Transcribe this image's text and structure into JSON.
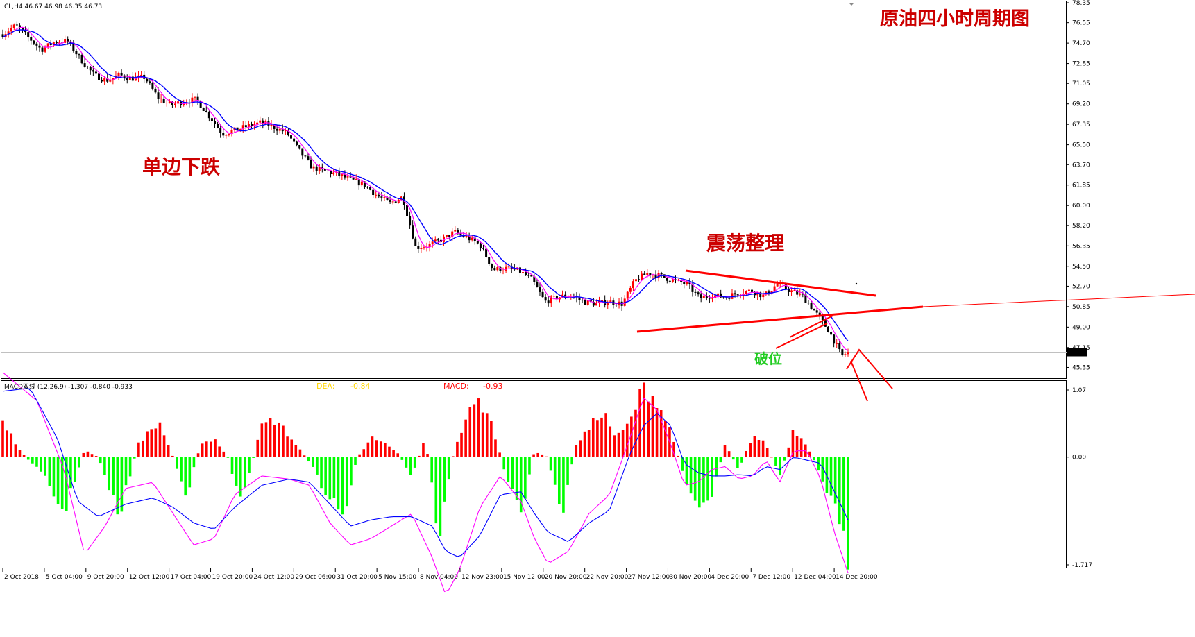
{
  "header": {
    "symbol_info": "CL,H4  46.67 46.98 46.35 46.73",
    "chart_title": "原油四小时周期图"
  },
  "annotations": {
    "trend": "单边下跌",
    "consolidation": "震荡整理",
    "breakdown": "破位"
  },
  "macd_header": {
    "label": "MACD双线 (12,26,9) -1.307 -0.840 -0.933",
    "dea_label": "DEA:",
    "dea_value": "-0.84",
    "macd_label": "MACD:",
    "macd_value": "-0.93"
  },
  "colors": {
    "bull_candle": "#ff0000",
    "bear_candle": "#000000",
    "ma_fast": "#ff00ff",
    "ma_slow": "#0000ff",
    "hist_positive": "#ff0000",
    "hist_negative": "#00ff00",
    "dea_label": "#ffd700",
    "macd_label": "#ff0000",
    "annotation_red": "#cc0000",
    "annotation_green": "#22cc22",
    "trendline": "#ff0000"
  },
  "chart_data": [
    {
      "type": "candlestick",
      "symbol": "CL",
      "timeframe": "H4",
      "last_price": "46.73",
      "ylim": [
        44.5,
        78.35
      ],
      "y_ticks": [
        "78.35",
        "76.55",
        "74.70",
        "72.85",
        "71.05",
        "69.20",
        "67.35",
        "65.50",
        "63.70",
        "61.85",
        "60.00",
        "58.20",
        "56.35",
        "54.50",
        "52.70",
        "50.85",
        "49.00",
        "47.15",
        "45.35"
      ],
      "x_ticks": [
        "2 Oct 2018",
        "5 Oct 04:00",
        "9 Oct 20:00",
        "12 Oct 12:00",
        "17 Oct 04:00",
        "19 Oct 20:00",
        "24 Oct 12:00",
        "29 Oct 06:00",
        "31 Oct 20:00",
        "5 Nov 15:00",
        "8 Nov 04:00",
        "12 Nov 23:00",
        "15 Nov 12:00",
        "20 Nov 20:00",
        "22 Nov 20:00",
        "27 Nov 12:00",
        "30 Nov 20:00",
        "4 Dec 20:00",
        "7 Dec 12:00",
        "12 Dec 04:00",
        "14 Dec 20:00"
      ],
      "price_path": [
        [
          0,
          75.5
        ],
        [
          2,
          76.3
        ],
        [
          4,
          75.2
        ],
        [
          6,
          74.1
        ],
        [
          8,
          74.8
        ],
        [
          10,
          74.9
        ],
        [
          12,
          73.3
        ],
        [
          14,
          71.9
        ],
        [
          16,
          71.3
        ],
        [
          18,
          71.8
        ],
        [
          20,
          71.5
        ],
        [
          22,
          71.6
        ],
        [
          24,
          69.8
        ],
        [
          26,
          69.1
        ],
        [
          28,
          69.4
        ],
        [
          30,
          69.6
        ],
        [
          32,
          68.1
        ],
        [
          34,
          66.5
        ],
        [
          36,
          66.8
        ],
        [
          38,
          67.2
        ],
        [
          40,
          67.5
        ],
        [
          42,
          67.1
        ],
        [
          44,
          66.6
        ],
        [
          46,
          64.9
        ],
        [
          48,
          63.4
        ],
        [
          50,
          63.1
        ],
        [
          52,
          62.8
        ],
        [
          54,
          62.3
        ],
        [
          56,
          61.9
        ],
        [
          58,
          60.9
        ],
        [
          60,
          60.2
        ],
        [
          62,
          60.8
        ],
        [
          64,
          56.2
        ],
        [
          66,
          56.4
        ],
        [
          68,
          56.9
        ],
        [
          70,
          57.6
        ],
        [
          72,
          57.1
        ],
        [
          74,
          56.4
        ],
        [
          76,
          54.2
        ],
        [
          78,
          54.3
        ],
        [
          80,
          54.1
        ],
        [
          82,
          53.3
        ],
        [
          84,
          51.3
        ],
        [
          86,
          51.7
        ],
        [
          88,
          51.9
        ],
        [
          90,
          51.3
        ],
        [
          92,
          51.1
        ],
        [
          94,
          51.3
        ],
        [
          96,
          51.1
        ],
        [
          98,
          53.2
        ],
        [
          100,
          53.9
        ],
        [
          102,
          53.6
        ],
        [
          104,
          53.2
        ],
        [
          106,
          52.9
        ],
        [
          108,
          51.6
        ],
        [
          110,
          51.9
        ],
        [
          112,
          51.7
        ],
        [
          114,
          52.1
        ],
        [
          116,
          52.3
        ],
        [
          118,
          51.8
        ],
        [
          120,
          52.9
        ],
        [
          122,
          52.3
        ],
        [
          124,
          51.8
        ],
        [
          126,
          50.3
        ],
        [
          128,
          48.7
        ],
        [
          130,
          46.4
        ],
        [
          131,
          46.7
        ]
      ],
      "overlays": [
        {
          "name": "MA fast",
          "color": "#ff00ff"
        },
        {
          "name": "MA slow",
          "color": "#0000ff"
        }
      ]
    },
    {
      "type": "bar+line",
      "indicator": "MACD",
      "params": "(12,26,9)",
      "ylim": [
        -1.717,
        1.07
      ],
      "y_ticks": [
        "1.07",
        "0.00",
        "-1.717"
      ],
      "histogram_path": [
        [
          0,
          0.55
        ],
        [
          3,
          0.05
        ],
        [
          6,
          -0.3
        ],
        [
          9,
          -0.9
        ],
        [
          12,
          0.12
        ],
        [
          14,
          0.0
        ],
        [
          17,
          -0.95
        ],
        [
          20,
          0.25
        ],
        [
          23,
          0.55
        ],
        [
          25,
          0.0
        ],
        [
          27,
          -0.6
        ],
        [
          29,
          0.2
        ],
        [
          31,
          0.3
        ],
        [
          33,
          0.0
        ],
        [
          35,
          -0.75
        ],
        [
          38,
          0.5
        ],
        [
          40,
          0.6
        ],
        [
          43,
          0.2
        ],
        [
          45,
          -0.08
        ],
        [
          47,
          -0.5
        ],
        [
          50,
          -0.95
        ],
        [
          52,
          0.0
        ],
        [
          54,
          0.3
        ],
        [
          56,
          0.2
        ],
        [
          58,
          0.06
        ],
        [
          60,
          -0.3
        ],
        [
          62,
          0.3
        ],
        [
          64,
          -1.3
        ],
        [
          66,
          0.0
        ],
        [
          68,
          0.65
        ],
        [
          70,
          0.9
        ],
        [
          72,
          0.45
        ],
        [
          74,
          -0.4
        ],
        [
          76,
          -0.9
        ],
        [
          78,
          0.1
        ],
        [
          80,
          0.0
        ],
        [
          82,
          -1.0
        ],
        [
          84,
          0.2
        ],
        [
          86,
          0.45
        ],
        [
          88,
          0.75
        ],
        [
          90,
          0.3
        ],
        [
          92,
          0.55
        ],
        [
          94,
          1.12
        ],
        [
          96,
          0.9
        ],
        [
          98,
          0.4
        ],
        [
          100,
          -0.3
        ],
        [
          102,
          -0.8
        ],
        [
          104,
          -0.6
        ],
        [
          106,
          0.2
        ],
        [
          108,
          -0.2
        ],
        [
          110,
          0.35
        ],
        [
          112,
          0.2
        ],
        [
          114,
          -0.3
        ],
        [
          116,
          0.45
        ],
        [
          118,
          0.2
        ],
        [
          120,
          -0.3
        ],
        [
          122,
          -0.8
        ],
        [
          124,
          -1.6
        ]
      ],
      "macd_line_path": [
        [
          0,
          1.35
        ],
        [
          5,
          0.9
        ],
        [
          9,
          -0.2
        ],
        [
          12,
          -1.55
        ],
        [
          15,
          -1.1
        ],
        [
          18,
          -0.5
        ],
        [
          22,
          -0.4
        ],
        [
          25,
          -0.9
        ],
        [
          28,
          -1.4
        ],
        [
          31,
          -1.3
        ],
        [
          34,
          -0.6
        ],
        [
          38,
          -0.3
        ],
        [
          42,
          -0.35
        ],
        [
          45,
          -0.45
        ],
        [
          48,
          -1.05
        ],
        [
          51,
          -1.4
        ],
        [
          54,
          -1.3
        ],
        [
          57,
          -1.1
        ],
        [
          60,
          -0.9
        ],
        [
          63,
          -1.6
        ],
        [
          65,
          -2.2
        ],
        [
          67,
          -1.8
        ],
        [
          70,
          -0.8
        ],
        [
          73,
          -0.3
        ],
        [
          76,
          -0.7
        ],
        [
          78,
          -1.3
        ],
        [
          80,
          -1.7
        ],
        [
          83,
          -1.5
        ],
        [
          86,
          -0.9
        ],
        [
          89,
          -0.6
        ],
        [
          92,
          0.3
        ],
        [
          94,
          0.95
        ],
        [
          96,
          0.75
        ],
        [
          98,
          0.2
        ],
        [
          100,
          -0.45
        ],
        [
          102,
          -0.4
        ],
        [
          104,
          -0.2
        ],
        [
          106,
          -0.15
        ],
        [
          108,
          -0.35
        ],
        [
          110,
          -0.3
        ],
        [
          112,
          -0.05
        ],
        [
          114,
          -0.4
        ],
        [
          116,
          0.1
        ],
        [
          118,
          0.1
        ],
        [
          120,
          -0.35
        ],
        [
          122,
          -1.2
        ],
        [
          124,
          -1.85
        ]
      ],
      "signal_line_path": [
        [
          0,
          1.05
        ],
        [
          4,
          1.1
        ],
        [
          8,
          0.3
        ],
        [
          11,
          -0.7
        ],
        [
          14,
          -0.95
        ],
        [
          18,
          -0.75
        ],
        [
          22,
          -0.65
        ],
        [
          25,
          -0.8
        ],
        [
          28,
          -1.05
        ],
        [
          31,
          -1.15
        ],
        [
          34,
          -0.8
        ],
        [
          38,
          -0.45
        ],
        [
          42,
          -0.35
        ],
        [
          45,
          -0.4
        ],
        [
          48,
          -0.75
        ],
        [
          51,
          -1.1
        ],
        [
          54,
          -1.0
        ],
        [
          57,
          -0.95
        ],
        [
          60,
          -0.95
        ],
        [
          63,
          -1.1
        ],
        [
          65,
          -1.5
        ],
        [
          67,
          -1.6
        ],
        [
          70,
          -1.25
        ],
        [
          73,
          -0.6
        ],
        [
          76,
          -0.55
        ],
        [
          78,
          -0.9
        ],
        [
          80,
          -1.2
        ],
        [
          83,
          -1.35
        ],
        [
          86,
          -1.05
        ],
        [
          89,
          -0.85
        ],
        [
          92,
          0.05
        ],
        [
          94,
          0.5
        ],
        [
          96,
          0.7
        ],
        [
          98,
          0.5
        ],
        [
          100,
          -0.1
        ],
        [
          102,
          -0.25
        ],
        [
          104,
          -0.3
        ],
        [
          106,
          -0.3
        ],
        [
          108,
          -0.28
        ],
        [
          110,
          -0.3
        ],
        [
          112,
          -0.15
        ],
        [
          114,
          -0.2
        ],
        [
          116,
          0.0
        ],
        [
          118,
          -0.05
        ],
        [
          120,
          -0.1
        ],
        [
          122,
          -0.55
        ],
        [
          124,
          -1.0
        ]
      ]
    }
  ]
}
